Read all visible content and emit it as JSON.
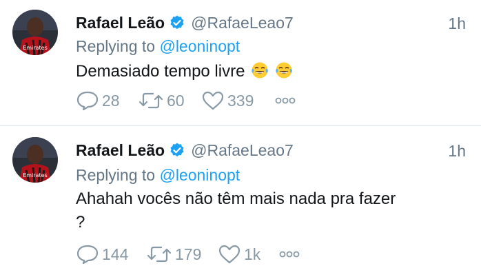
{
  "colors": {
    "link": "#1da1f2",
    "secondary_text": "#657786",
    "action_icon": "#8899a6",
    "verified": "#1da1f2",
    "divider": "#e1e8ed"
  },
  "tweets": [
    {
      "name": "Rafael Leão",
      "handle": "@RafaeLeao7",
      "time": "1h",
      "replying_prefix": "Replying to",
      "replying_to": "@leoninopt",
      "text": "Demasiado tempo livre",
      "emojis": [
        "face-with-tears-of-joy",
        "face-with-tears-of-joy"
      ],
      "avatar_text": "Emirates",
      "actions": {
        "replies": "28",
        "retweets": "60",
        "likes": "339"
      }
    },
    {
      "name": "Rafael Leão",
      "handle": "@RafaeLeao7",
      "time": "1h",
      "replying_prefix": "Replying to",
      "replying_to": "@leoninopt",
      "text_line1": "Ahahah vocês não têm mais nada pra fazer",
      "text_line2": "?",
      "avatar_text": "Emirates",
      "actions": {
        "replies": "144",
        "retweets": "179",
        "likes": "1k"
      }
    }
  ]
}
